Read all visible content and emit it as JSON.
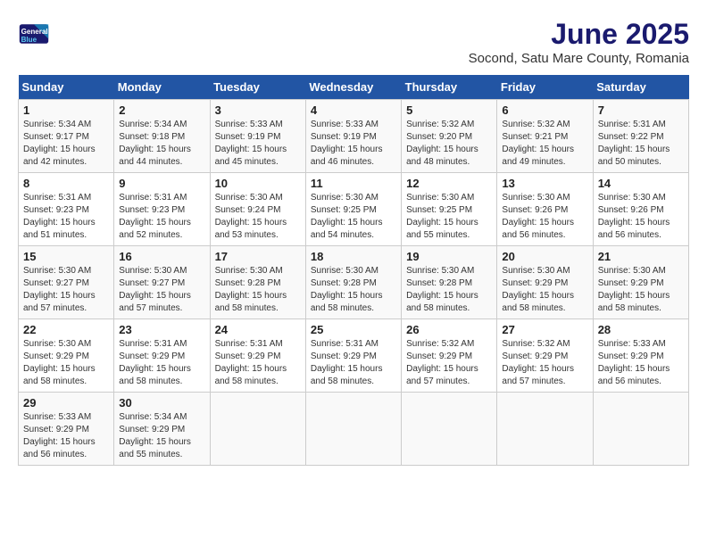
{
  "logo": {
    "line1": "General",
    "line2": "Blue"
  },
  "title": "June 2025",
  "subtitle": "Socond, Satu Mare County, Romania",
  "days_of_week": [
    "Sunday",
    "Monday",
    "Tuesday",
    "Wednesday",
    "Thursday",
    "Friday",
    "Saturday"
  ],
  "weeks": [
    [
      {
        "day": "1",
        "sunrise": "Sunrise: 5:34 AM",
        "sunset": "Sunset: 9:17 PM",
        "daylight": "Daylight: 15 hours and 42 minutes."
      },
      {
        "day": "2",
        "sunrise": "Sunrise: 5:34 AM",
        "sunset": "Sunset: 9:18 PM",
        "daylight": "Daylight: 15 hours and 44 minutes."
      },
      {
        "day": "3",
        "sunrise": "Sunrise: 5:33 AM",
        "sunset": "Sunset: 9:19 PM",
        "daylight": "Daylight: 15 hours and 45 minutes."
      },
      {
        "day": "4",
        "sunrise": "Sunrise: 5:33 AM",
        "sunset": "Sunset: 9:19 PM",
        "daylight": "Daylight: 15 hours and 46 minutes."
      },
      {
        "day": "5",
        "sunrise": "Sunrise: 5:32 AM",
        "sunset": "Sunset: 9:20 PM",
        "daylight": "Daylight: 15 hours and 48 minutes."
      },
      {
        "day": "6",
        "sunrise": "Sunrise: 5:32 AM",
        "sunset": "Sunset: 9:21 PM",
        "daylight": "Daylight: 15 hours and 49 minutes."
      },
      {
        "day": "7",
        "sunrise": "Sunrise: 5:31 AM",
        "sunset": "Sunset: 9:22 PM",
        "daylight": "Daylight: 15 hours and 50 minutes."
      }
    ],
    [
      {
        "day": "8",
        "sunrise": "Sunrise: 5:31 AM",
        "sunset": "Sunset: 9:23 PM",
        "daylight": "Daylight: 15 hours and 51 minutes."
      },
      {
        "day": "9",
        "sunrise": "Sunrise: 5:31 AM",
        "sunset": "Sunset: 9:23 PM",
        "daylight": "Daylight: 15 hours and 52 minutes."
      },
      {
        "day": "10",
        "sunrise": "Sunrise: 5:30 AM",
        "sunset": "Sunset: 9:24 PM",
        "daylight": "Daylight: 15 hours and 53 minutes."
      },
      {
        "day": "11",
        "sunrise": "Sunrise: 5:30 AM",
        "sunset": "Sunset: 9:25 PM",
        "daylight": "Daylight: 15 hours and 54 minutes."
      },
      {
        "day": "12",
        "sunrise": "Sunrise: 5:30 AM",
        "sunset": "Sunset: 9:25 PM",
        "daylight": "Daylight: 15 hours and 55 minutes."
      },
      {
        "day": "13",
        "sunrise": "Sunrise: 5:30 AM",
        "sunset": "Sunset: 9:26 PM",
        "daylight": "Daylight: 15 hours and 56 minutes."
      },
      {
        "day": "14",
        "sunrise": "Sunrise: 5:30 AM",
        "sunset": "Sunset: 9:26 PM",
        "daylight": "Daylight: 15 hours and 56 minutes."
      }
    ],
    [
      {
        "day": "15",
        "sunrise": "Sunrise: 5:30 AM",
        "sunset": "Sunset: 9:27 PM",
        "daylight": "Daylight: 15 hours and 57 minutes."
      },
      {
        "day": "16",
        "sunrise": "Sunrise: 5:30 AM",
        "sunset": "Sunset: 9:27 PM",
        "daylight": "Daylight: 15 hours and 57 minutes."
      },
      {
        "day": "17",
        "sunrise": "Sunrise: 5:30 AM",
        "sunset": "Sunset: 9:28 PM",
        "daylight": "Daylight: 15 hours and 58 minutes."
      },
      {
        "day": "18",
        "sunrise": "Sunrise: 5:30 AM",
        "sunset": "Sunset: 9:28 PM",
        "daylight": "Daylight: 15 hours and 58 minutes."
      },
      {
        "day": "19",
        "sunrise": "Sunrise: 5:30 AM",
        "sunset": "Sunset: 9:28 PM",
        "daylight": "Daylight: 15 hours and 58 minutes."
      },
      {
        "day": "20",
        "sunrise": "Sunrise: 5:30 AM",
        "sunset": "Sunset: 9:29 PM",
        "daylight": "Daylight: 15 hours and 58 minutes."
      },
      {
        "day": "21",
        "sunrise": "Sunrise: 5:30 AM",
        "sunset": "Sunset: 9:29 PM",
        "daylight": "Daylight: 15 hours and 58 minutes."
      }
    ],
    [
      {
        "day": "22",
        "sunrise": "Sunrise: 5:30 AM",
        "sunset": "Sunset: 9:29 PM",
        "daylight": "Daylight: 15 hours and 58 minutes."
      },
      {
        "day": "23",
        "sunrise": "Sunrise: 5:31 AM",
        "sunset": "Sunset: 9:29 PM",
        "daylight": "Daylight: 15 hours and 58 minutes."
      },
      {
        "day": "24",
        "sunrise": "Sunrise: 5:31 AM",
        "sunset": "Sunset: 9:29 PM",
        "daylight": "Daylight: 15 hours and 58 minutes."
      },
      {
        "day": "25",
        "sunrise": "Sunrise: 5:31 AM",
        "sunset": "Sunset: 9:29 PM",
        "daylight": "Daylight: 15 hours and 58 minutes."
      },
      {
        "day": "26",
        "sunrise": "Sunrise: 5:32 AM",
        "sunset": "Sunset: 9:29 PM",
        "daylight": "Daylight: 15 hours and 57 minutes."
      },
      {
        "day": "27",
        "sunrise": "Sunrise: 5:32 AM",
        "sunset": "Sunset: 9:29 PM",
        "daylight": "Daylight: 15 hours and 57 minutes."
      },
      {
        "day": "28",
        "sunrise": "Sunrise: 5:33 AM",
        "sunset": "Sunset: 9:29 PM",
        "daylight": "Daylight: 15 hours and 56 minutes."
      }
    ],
    [
      {
        "day": "29",
        "sunrise": "Sunrise: 5:33 AM",
        "sunset": "Sunset: 9:29 PM",
        "daylight": "Daylight: 15 hours and 56 minutes."
      },
      {
        "day": "30",
        "sunrise": "Sunrise: 5:34 AM",
        "sunset": "Sunset: 9:29 PM",
        "daylight": "Daylight: 15 hours and 55 minutes."
      },
      null,
      null,
      null,
      null,
      null
    ]
  ]
}
